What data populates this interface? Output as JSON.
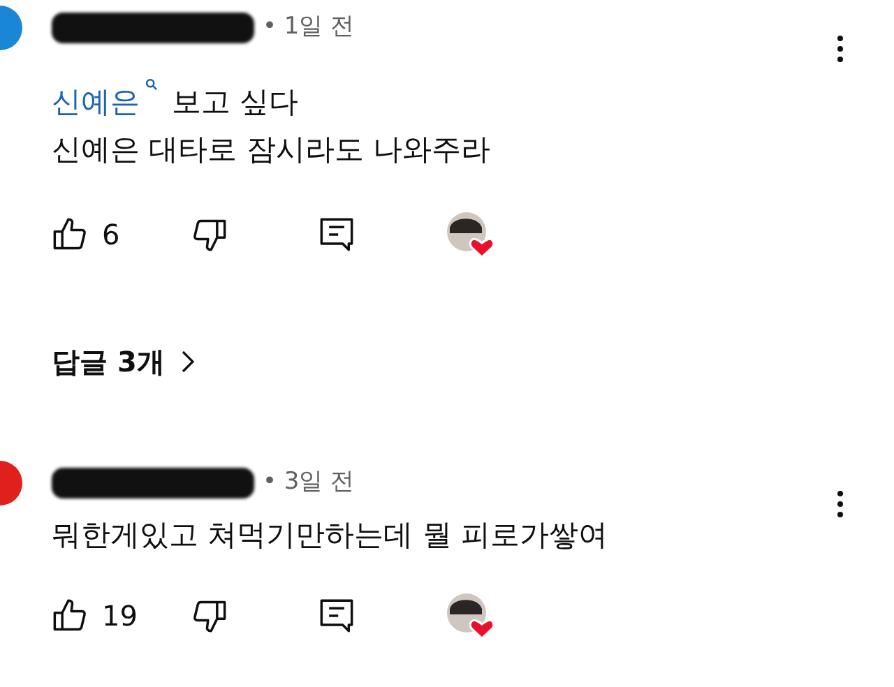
{
  "comments": [
    {
      "color": "#1a87d6",
      "posted": "• 1일 전",
      "lines": [
        [
          {
            "kind": "search-link",
            "text": "신예은"
          },
          {
            "kind": "plain",
            "text": "보고 싶다"
          }
        ],
        [
          {
            "kind": "plain",
            "text": "신예은 대타로 잠시라도 나와주라"
          }
        ]
      ],
      "likes": "6",
      "creator_hearted": true,
      "replies": "답글 3개"
    },
    {
      "color": "#e0201c",
      "posted": "• 3일 전",
      "lines": [
        [
          {
            "kind": "plain",
            "text": "뭐한게있고 쳐먹기만하는데 뭘 피로가쌓여"
          }
        ]
      ],
      "likes": "19",
      "creator_hearted": true
    }
  ]
}
